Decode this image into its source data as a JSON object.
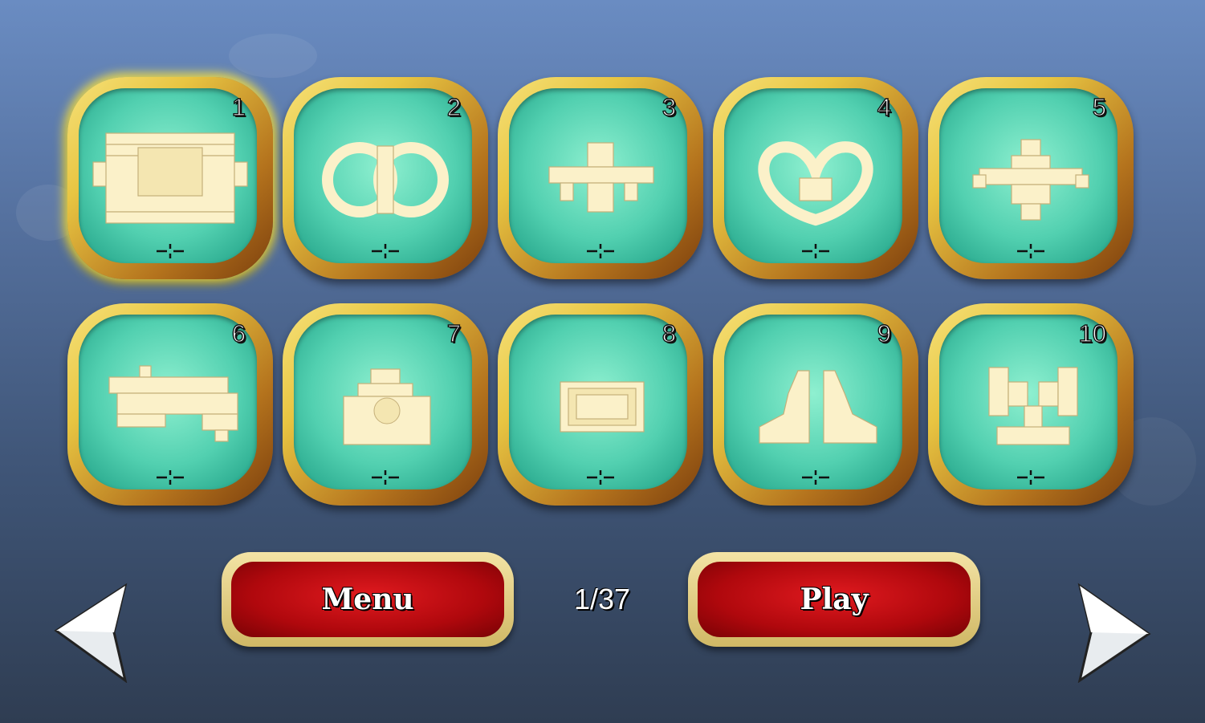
{
  "levels": [
    {
      "number": "1",
      "selected": true
    },
    {
      "number": "2",
      "selected": false
    },
    {
      "number": "3",
      "selected": false
    },
    {
      "number": "4",
      "selected": false
    },
    {
      "number": "5",
      "selected": false
    },
    {
      "number": "6",
      "selected": false
    },
    {
      "number": "7",
      "selected": false
    },
    {
      "number": "8",
      "selected": false
    },
    {
      "number": "9",
      "selected": false
    },
    {
      "number": "10",
      "selected": false
    }
  ],
  "buttons": {
    "menu_label": "Menu",
    "play_label": "Play"
  },
  "pager": {
    "text": "1/37"
  },
  "icons": {
    "prev": "left-arrow-icon",
    "next": "right-arrow-icon",
    "difficulty": "crosshair-icon"
  },
  "colors": {
    "frame_gold": "#e8c542",
    "tile_teal": "#52d0b0",
    "button_red": "#b0080d",
    "button_border": "#d0b865",
    "background_top": "#6a8cc2",
    "background_bottom": "#2f3d52",
    "tile_cream": "#fbf1c9"
  }
}
